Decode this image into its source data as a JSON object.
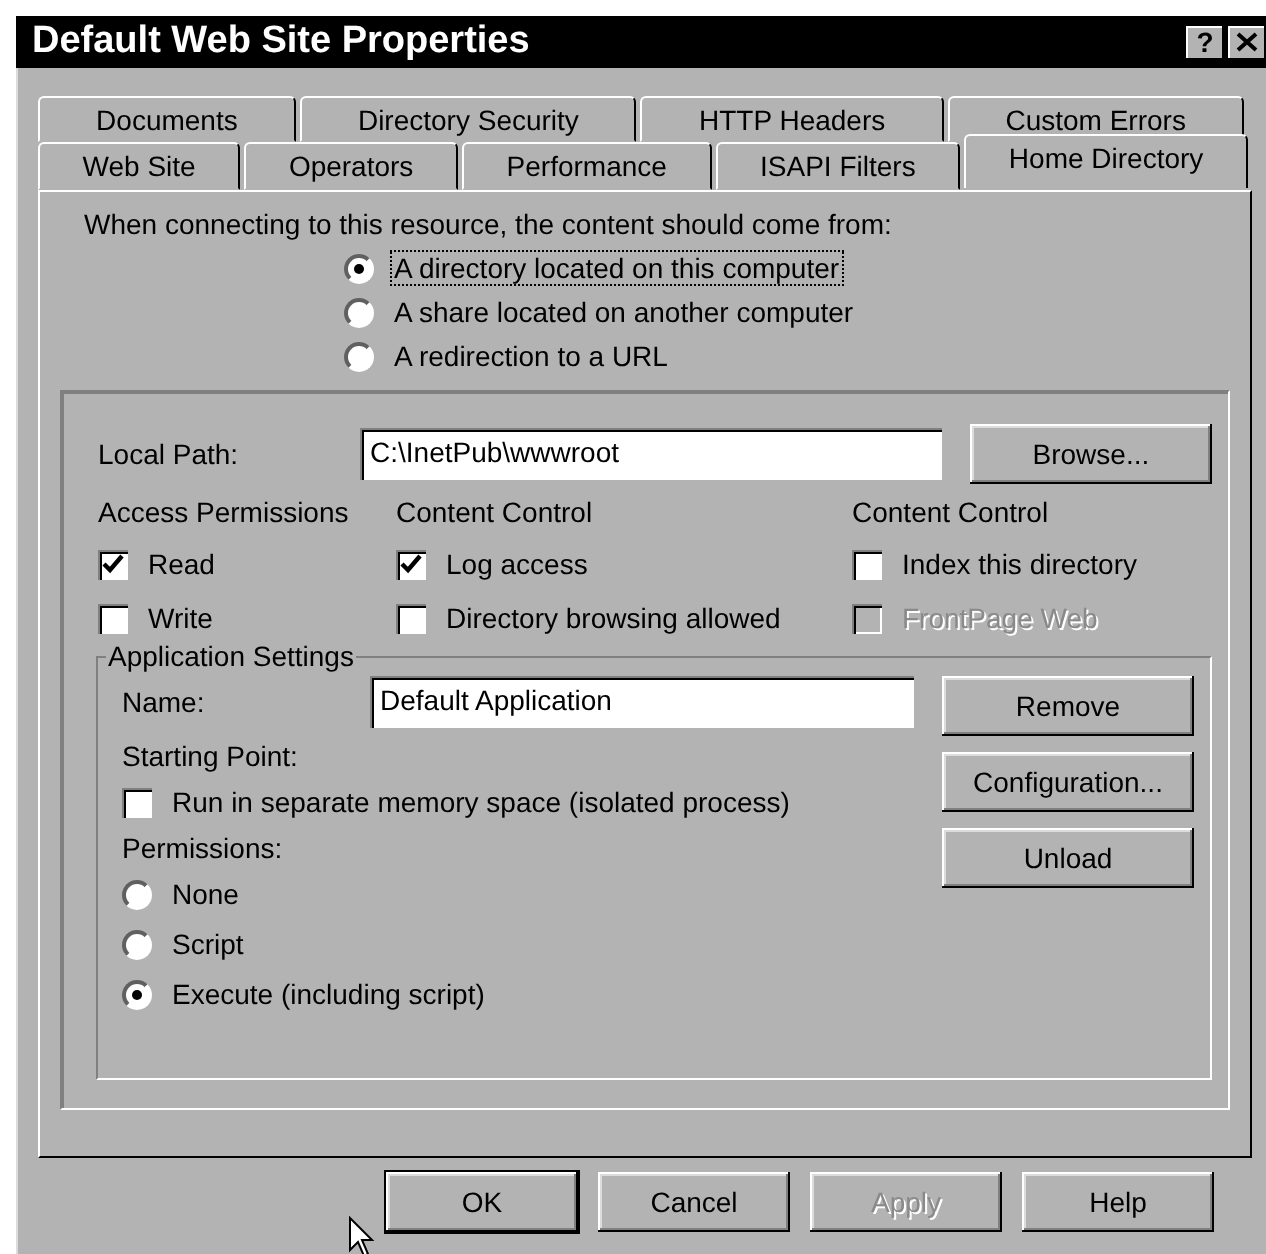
{
  "window": {
    "title": "Default Web Site Properties",
    "help_button": "?"
  },
  "tab_rows": [
    [
      {
        "label": "Documents",
        "selected": false
      },
      {
        "label": "Directory Security",
        "selected": false
      },
      {
        "label": "HTTP Headers",
        "selected": false
      },
      {
        "label": "Custom Errors",
        "selected": false
      }
    ],
    [
      {
        "label": "Web Site",
        "selected": false
      },
      {
        "label": "Operators",
        "selected": false
      },
      {
        "label": "Performance",
        "selected": false
      },
      {
        "label": "ISAPI Filters",
        "selected": false
      },
      {
        "label": "Home Directory",
        "selected": true
      }
    ]
  ],
  "source": {
    "prompt": "When connecting to this resource, the content should come from:",
    "options": [
      {
        "label": "A directory located on this computer",
        "selected": true,
        "focused": true
      },
      {
        "label": "A share located on another computer",
        "selected": false,
        "focused": false
      },
      {
        "label": "A redirection to a URL",
        "selected": false,
        "focused": false
      }
    ]
  },
  "local_path": {
    "label": "Local Path:",
    "value": "C:\\InetPub\\wwwroot",
    "browse_button": "Browse..."
  },
  "columns": [
    {
      "heading": "Access Permissions",
      "checks": [
        {
          "label": "Read",
          "checked": true,
          "disabled": false
        },
        {
          "label": "Write",
          "checked": false,
          "disabled": false
        }
      ]
    },
    {
      "heading": "Content Control",
      "checks": [
        {
          "label": "Log access",
          "checked": true,
          "disabled": false
        },
        {
          "label": "Directory browsing allowed",
          "checked": false,
          "disabled": false
        }
      ]
    },
    {
      "heading": "Content Control",
      "checks": [
        {
          "label": "Index this directory",
          "checked": false,
          "disabled": false
        },
        {
          "label": "FrontPage Web",
          "checked": false,
          "disabled": true
        }
      ]
    }
  ],
  "application_settings": {
    "legend": "Application Settings",
    "name_label": "Name:",
    "name_value": "Default Application",
    "starting_point": "Starting Point:",
    "isolated": {
      "label": "Run in separate memory space (isolated process)",
      "checked": false
    },
    "permissions_label": "Permissions:",
    "permissions": [
      {
        "label": "None",
        "selected": false
      },
      {
        "label": "Script",
        "selected": false
      },
      {
        "label": "Execute (including script)",
        "selected": true
      }
    ],
    "buttons": [
      {
        "label": "Remove",
        "disabled": false
      },
      {
        "label": "Configuration...",
        "disabled": false
      },
      {
        "label": "Unload",
        "disabled": false
      }
    ]
  },
  "buttons": [
    {
      "label": "OK",
      "default": true,
      "disabled": false
    },
    {
      "label": "Cancel",
      "default": false,
      "disabled": false
    },
    {
      "label": "Apply",
      "default": false,
      "disabled": true
    },
    {
      "label": "Help",
      "default": false,
      "disabled": false
    }
  ]
}
